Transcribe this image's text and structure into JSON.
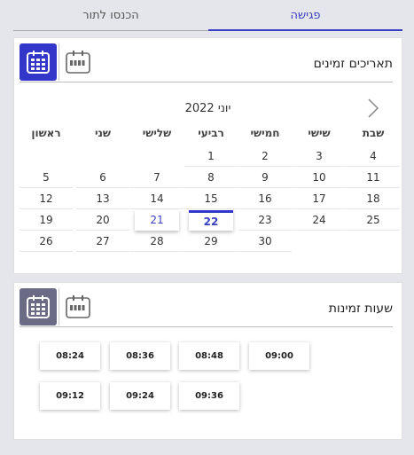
{
  "tabs": [
    {
      "label": "פגישה"
    },
    {
      "label": "הכנסו לתור"
    }
  ],
  "dates_card": {
    "title": "תאריכים זמינים",
    "month_label": "יוני 2022",
    "weekdays": [
      "שבת",
      "שישי",
      "חמישי",
      "רביעי",
      "שלישי",
      "שני",
      "ראשון"
    ],
    "weeks": [
      [
        "4",
        "3",
        "2",
        "1",
        "",
        "",
        ""
      ],
      [
        "11",
        "10",
        "9",
        "8",
        "7",
        "6",
        "5"
      ],
      [
        "18",
        "17",
        "16",
        "15",
        "14",
        "13",
        "12"
      ],
      [
        "25",
        "24",
        "23",
        "22",
        "21",
        "20",
        "19"
      ],
      [
        "",
        "",
        "30",
        "29",
        "28",
        "27",
        "26"
      ]
    ],
    "today": "21",
    "selected": "22"
  },
  "times_card": {
    "title": "שעות זמינות",
    "slots_row1": [
      "09:00",
      "08:48",
      "08:36",
      "08:24"
    ],
    "slots_row2": [
      "09:36",
      "09:24",
      "09:12"
    ]
  },
  "colors": {
    "accent": "#3237c9",
    "gray_icon": "#6b6b85"
  }
}
